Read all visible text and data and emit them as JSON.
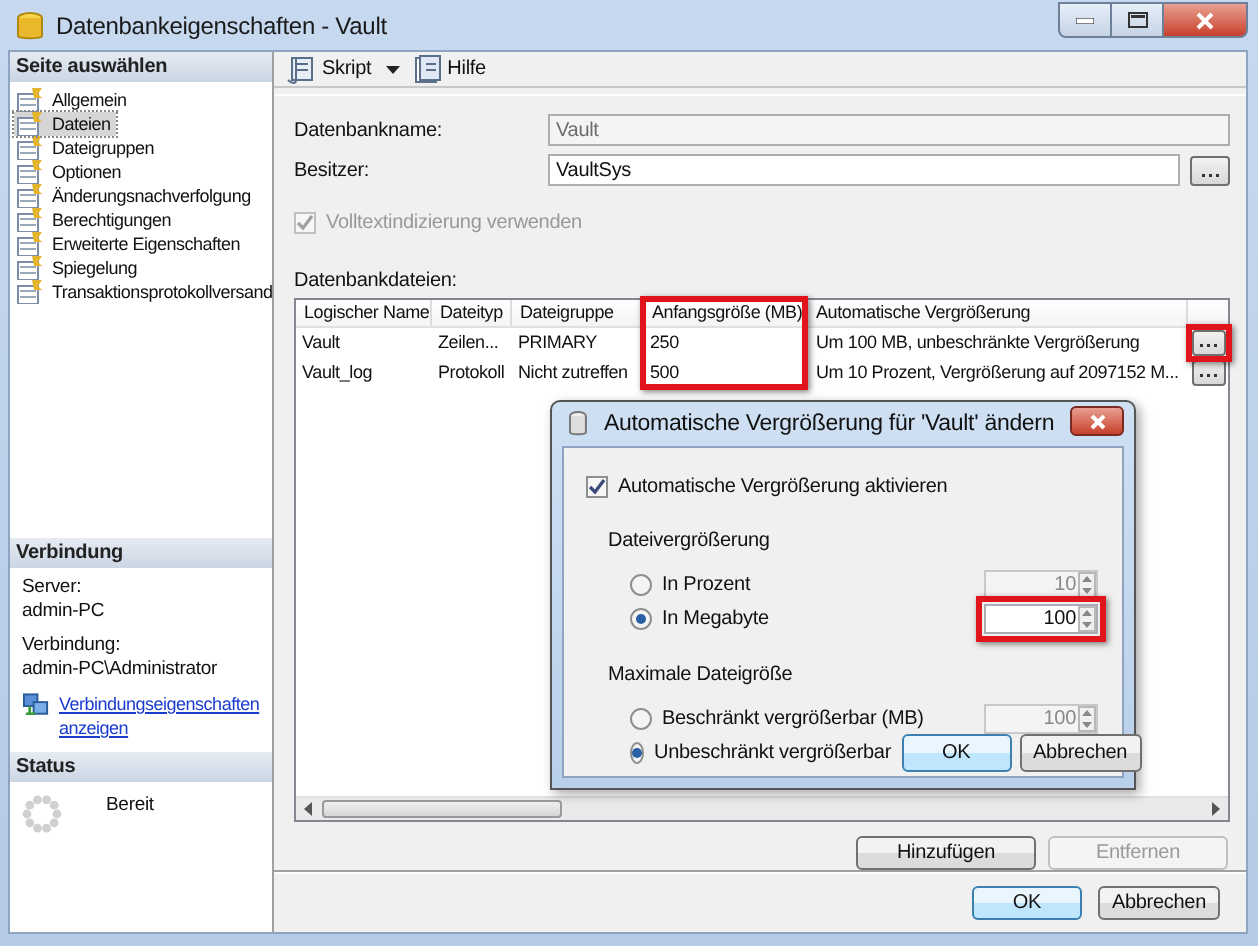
{
  "window": {
    "title": "Datenbankeigenschaften - Vault"
  },
  "sidebar": {
    "header": "Seite auswählen",
    "items": [
      {
        "label": "Allgemein",
        "selected": false
      },
      {
        "label": "Dateien",
        "selected": true
      },
      {
        "label": "Dateigruppen",
        "selected": false
      },
      {
        "label": "Optionen",
        "selected": false
      },
      {
        "label": "Änderungsnachverfolgung",
        "selected": false
      },
      {
        "label": "Berechtigungen",
        "selected": false
      },
      {
        "label": "Erweiterte Eigenschaften",
        "selected": false
      },
      {
        "label": "Spiegelung",
        "selected": false
      },
      {
        "label": "Transaktionsprotokollversand",
        "selected": false
      }
    ]
  },
  "connection": {
    "header": "Verbindung",
    "server_label": "Server:",
    "server": "admin-PC",
    "connection_label": "Verbindung:",
    "connection": "admin-PC\\Administrator",
    "link": "Verbindungseigenschaften anzeigen"
  },
  "status": {
    "header": "Status",
    "text": "Bereit"
  },
  "toolbar": {
    "items": [
      {
        "label": "Skript",
        "kind": "dropdown"
      },
      {
        "label": "Hilfe",
        "kind": "button"
      }
    ]
  },
  "form": {
    "database_name": {
      "label": "Datenbankname:",
      "value": "Vault",
      "disabled": true
    },
    "owner": {
      "label": "Besitzer:",
      "value": "VaultSys"
    },
    "fulltext": {
      "label": "Volltextindizierung verwenden",
      "checked": true,
      "disabled": true
    }
  },
  "files": {
    "label": "Datenbankdateien:",
    "columns": [
      {
        "label": "Logischer Name"
      },
      {
        "label": "Dateityp"
      },
      {
        "label": "Dateigruppe"
      },
      {
        "label": "Anfangsgröße (MB)",
        "highlighted": true
      },
      {
        "label": "Automatische Vergrößerung"
      }
    ],
    "rows": [
      {
        "cells": [
          "Vault",
          "Zeilen...",
          "PRIMARY",
          "250",
          "Um 100 MB, unbeschränkte Vergrößerung"
        ],
        "button_highlighted": true
      },
      {
        "cells": [
          "Vault_log",
          "Protokoll",
          "Nicht zutreffen",
          "500",
          "Um 10 Prozent, Vergrößerung auf 2097152 M..."
        ]
      }
    ],
    "buttons": [
      {
        "label": "Hinzufügen",
        "disabled": false
      },
      {
        "label": "Entfernen",
        "disabled": true
      }
    ]
  },
  "footer_buttons": [
    {
      "label": "OK",
      "default": true
    },
    {
      "label": "Abbrechen",
      "default": false
    }
  ],
  "dialog": {
    "title": "Automatische Vergrößerung für 'Vault' ändern",
    "enable": {
      "label": "Automatische Vergrößerung aktivieren",
      "checked": true
    },
    "groups": [
      {
        "label": "Dateivergrößerung",
        "options": [
          {
            "label": "In Prozent",
            "selected": false,
            "spinner": {
              "value": "10",
              "disabled": true
            }
          },
          {
            "label": "In Megabyte",
            "selected": true,
            "spinner": {
              "value": "100",
              "disabled": false,
              "highlighted": true
            }
          }
        ]
      },
      {
        "label": "Maximale Dateigröße",
        "options": [
          {
            "label": "Beschränkt vergrößerbar (MB)",
            "selected": false,
            "spinner": {
              "value": "100",
              "disabled": true
            }
          },
          {
            "label": "Unbeschränkt vergrößerbar",
            "selected": true
          }
        ]
      }
    ],
    "buttons": [
      {
        "label": "OK",
        "default": true
      },
      {
        "label": "Abbrechen",
        "default": false
      }
    ]
  }
}
